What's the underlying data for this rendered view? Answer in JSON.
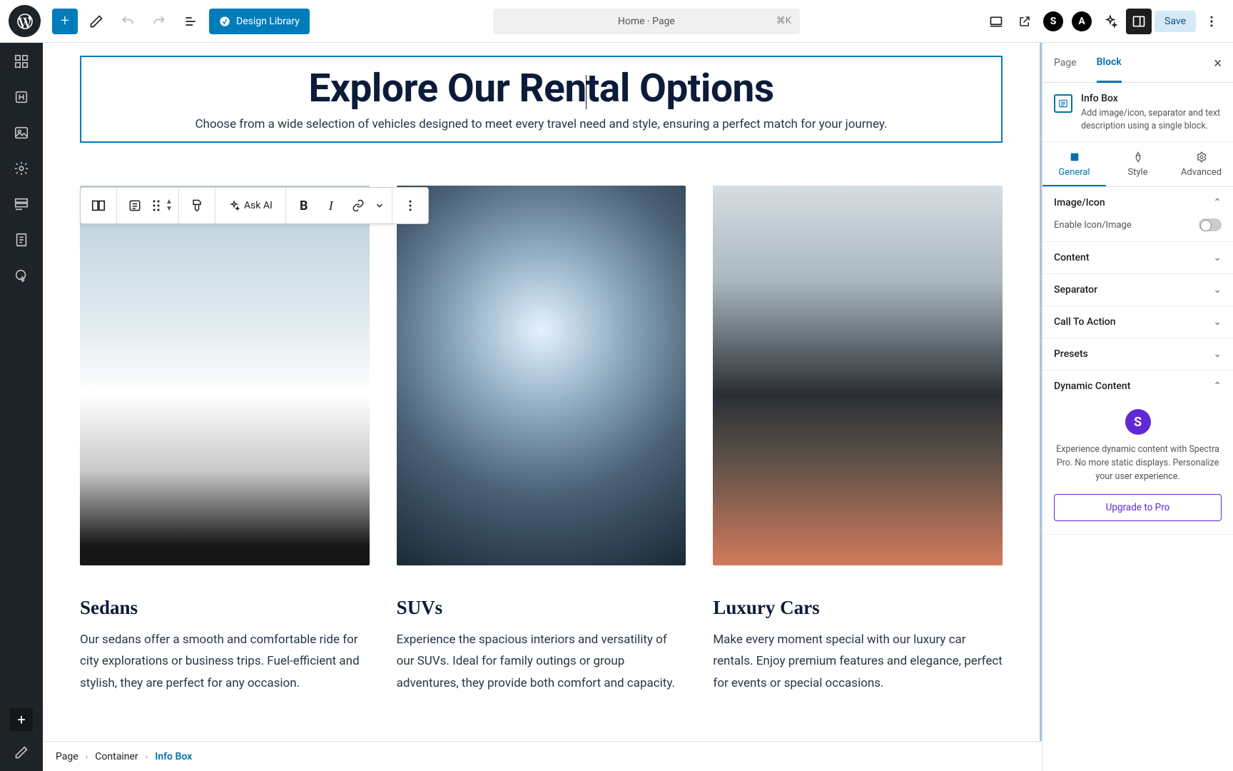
{
  "toolbar": {
    "design_library": "Design Library",
    "doc_title": "Home · Page",
    "shortcut": "⌘K",
    "save": "Save"
  },
  "canvas": {
    "heading_pre": "Explore Our Ren",
    "heading_post": "tal Options",
    "subheading": "Choose from a wide selection of vehicles designed to meet every travel need and style, ensuring a perfect match for your journey."
  },
  "block_toolbar": {
    "ask_ai": "Ask AI",
    "bold": "B",
    "italic": "I"
  },
  "cards": [
    {
      "title": "Sedans",
      "body": "Our sedans offer a smooth and comfortable ride for city explorations or business trips. Fuel-efficient and stylish, they are perfect for any occasion."
    },
    {
      "title": "SUVs",
      "body": "Experience the spacious interiors and versatility of our SUVs. Ideal for family outings or group adventures, they provide both comfort and capacity."
    },
    {
      "title": "Luxury Cars",
      "body": "Make every moment special with our luxury car rentals. Enjoy premium features and elegance, perfect for events or special occasions."
    }
  ],
  "sidebar": {
    "tabs": {
      "page": "Page",
      "block": "Block"
    },
    "block_name": "Info Box",
    "block_desc": "Add image/icon, separator and text description using a single block.",
    "subtabs": {
      "general": "General",
      "style": "Style",
      "advanced": "Advanced"
    },
    "panels": {
      "image_icon": "Image/Icon",
      "enable_icon": "Enable Icon/Image",
      "content": "Content",
      "separator": "Separator",
      "cta": "Call To Action",
      "presets": "Presets",
      "dynamic": "Dynamic Content"
    },
    "dynamic_text": "Experience dynamic content with Spectra Pro. No more static displays. Personalize your user experience.",
    "upgrade": "Upgrade to Pro"
  },
  "breadcrumb": {
    "l1": "Page",
    "l2": "Container",
    "l3": "Info Box"
  }
}
